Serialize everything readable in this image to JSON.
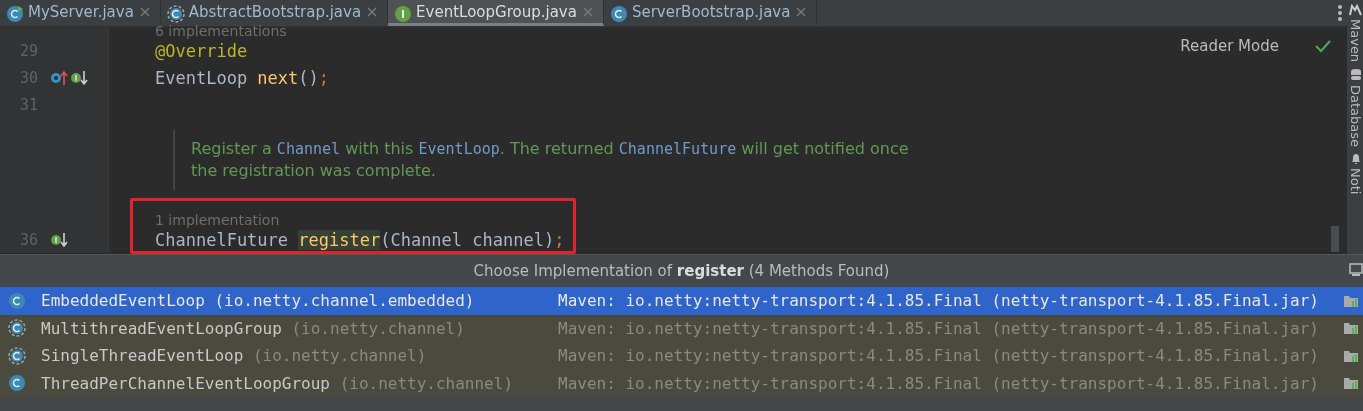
{
  "tabs": [
    {
      "label": "MyServer.java",
      "kind": "runnable-class",
      "selected": false
    },
    {
      "label": "AbstractBootstrap.java",
      "kind": "abstract-class",
      "selected": false
    },
    {
      "label": "EventLoopGroup.java",
      "kind": "interface",
      "selected": true
    },
    {
      "label": "ServerBootstrap.java",
      "kind": "class",
      "selected": false
    }
  ],
  "editor": {
    "reader_mode": "Reader Mode",
    "lines": [
      {
        "kind": "hint",
        "text": "6 implementations"
      },
      {
        "kind": "code",
        "number": "29",
        "marked": false,
        "tokens": [
          {
            "kind": "annotation",
            "text": "@Override"
          }
        ]
      },
      {
        "kind": "code",
        "number": "30",
        "gutter": [
          {
            "kind": "overrides"
          },
          {
            "kind": "implemented"
          }
        ],
        "marked": false,
        "tokens": [
          {
            "kind": "plain",
            "text": "EventLoop "
          },
          {
            "kind": "method",
            "text": "next"
          },
          {
            "kind": "plain",
            "text": "()"
          },
          {
            "kind": "punct",
            "text": ";"
          }
        ]
      },
      {
        "kind": "code",
        "number": "31",
        "marked": false
      },
      {
        "kind": "doc",
        "parts": [
          {
            "kind": "prose",
            "text": "Register a "
          },
          {
            "kind": "ref",
            "text": "Channel"
          },
          {
            "kind": "prose",
            "text": " with this "
          },
          {
            "kind": "ref",
            "text": "EventLoop"
          },
          {
            "kind": "prose",
            "text": ". The returned "
          },
          {
            "kind": "ref",
            "text": "ChannelFuture"
          },
          {
            "kind": "prose",
            "text": " will get notified once the registration was complete."
          }
        ]
      },
      {
        "kind": "hint",
        "text": "1 implementation"
      },
      {
        "kind": "code",
        "number": "36",
        "gutter": [
          {
            "kind": "implemented"
          }
        ],
        "marked": true,
        "tokens": [
          {
            "kind": "plain",
            "text": "ChannelFuture "
          },
          {
            "kind": "usage",
            "text": "register"
          },
          {
            "kind": "plain",
            "text": "(Channel channel)"
          },
          {
            "kind": "punct",
            "text": ";"
          }
        ]
      }
    ]
  },
  "side_tools": [
    {
      "label": "Maven",
      "kind": "maven"
    },
    {
      "label": "Database",
      "kind": "database"
    },
    {
      "label": "Noti",
      "kind": "notifications"
    }
  ],
  "popup": {
    "title": "Choose Implementation of **register** (4 Methods Found)",
    "rows": [
      {
        "name": "EmbeddedEventLoop",
        "package": "(io.netty.channel.embedded)",
        "location": "Maven: io.netty:netty-transport:4.1.85.Final (netty-transport-4.1.85.Final.jar)",
        "kind": "class",
        "selected": true
      },
      {
        "name": "MultithreadEventLoopGroup",
        "package": "(io.netty.channel)",
        "location": "Maven: io.netty:netty-transport:4.1.85.Final (netty-transport-4.1.85.Final.jar)",
        "kind": "abstract-class",
        "selected": false
      },
      {
        "name": "SingleThreadEventLoop",
        "package": "(io.netty.channel)",
        "location": "Maven: io.netty:netty-transport:4.1.85.Final (netty-transport-4.1.85.Final.jar)",
        "kind": "abstract-class",
        "selected": false
      },
      {
        "name": "ThreadPerChannelEventLoopGroup",
        "package": "(io.netty.channel)",
        "location": "Maven: io.netty:netty-transport:4.1.85.Final (netty-transport-4.1.85.Final.jar)",
        "kind": "class",
        "selected": false
      }
    ]
  }
}
